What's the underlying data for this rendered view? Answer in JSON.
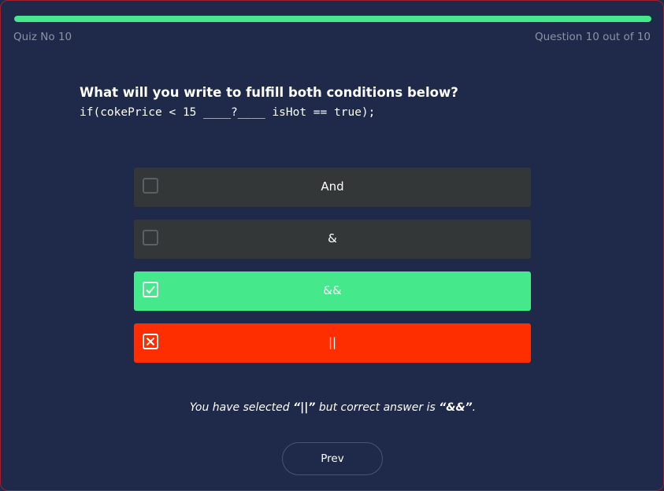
{
  "progress": {
    "fraction": 1.0,
    "color": "#45e88b"
  },
  "header": {
    "quiz_label": "Quiz No 10",
    "question_counter": "Question 10 out of 10"
  },
  "question": {
    "text": "What will you write to fulfill both conditions below?",
    "code": "if(cokePrice < 15 ____?____ isHot == true);"
  },
  "options": [
    {
      "label": "And",
      "state": "unselected"
    },
    {
      "label": "&",
      "state": "unselected"
    },
    {
      "label": "&&",
      "state": "correct"
    },
    {
      "label": "||",
      "state": "wrong"
    }
  ],
  "feedback": {
    "prefix": "You have selected ",
    "selected": "“||”",
    "middle": " but correct answer is ",
    "correct": "“&&”",
    "suffix": "."
  },
  "buttons": {
    "prev_label": "Prev"
  },
  "colors": {
    "background": "#1f2a4a",
    "correct": "#45e88b",
    "wrong": "#ff2e00",
    "option_default": "#333738"
  }
}
